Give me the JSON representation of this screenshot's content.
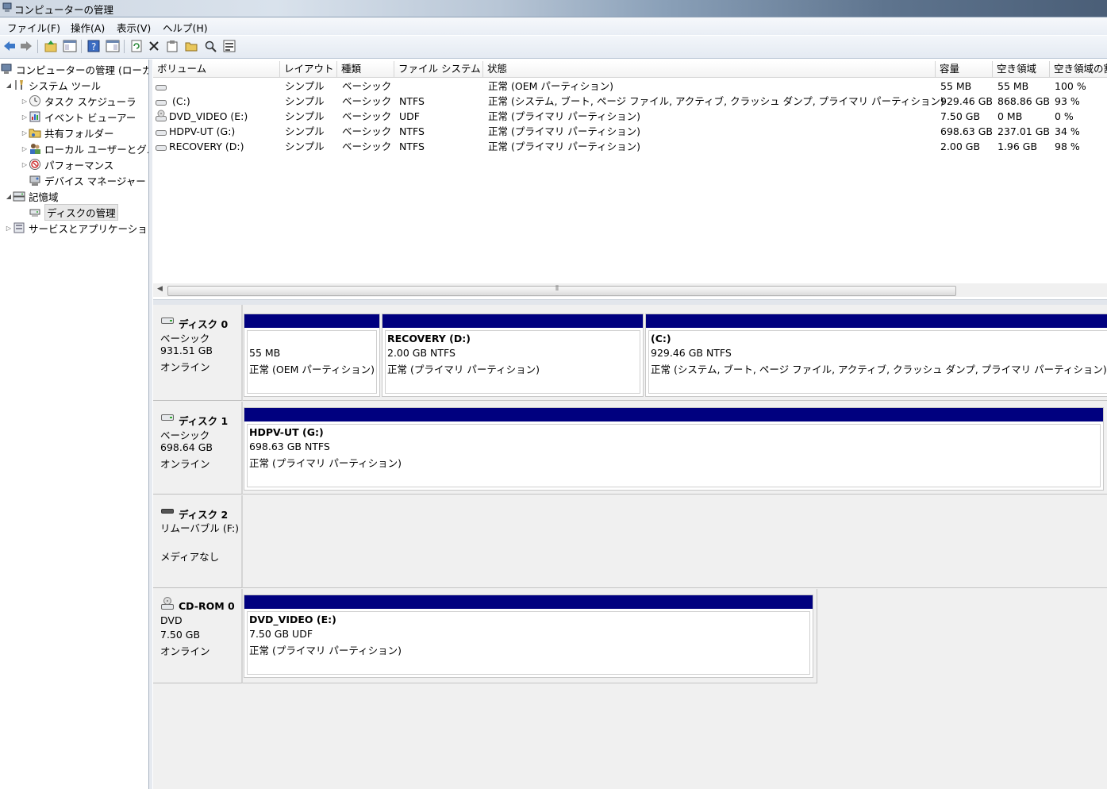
{
  "window": {
    "title": "コンピューターの管理"
  },
  "menu": [
    "ファイル(F)",
    "操作(A)",
    "表示(V)",
    "ヘルプ(H)"
  ],
  "toolbar_icons": [
    "back-arrow-icon",
    "forward-arrow-icon",
    "up-folder-icon",
    "show-hide-tree-icon",
    "help-icon",
    "action-pane-icon",
    "refresh-icon",
    "delete-icon",
    "properties-icon",
    "open-folder-icon",
    "search-icon",
    "settings-icon"
  ],
  "tree": {
    "root": "コンピューターの管理 (ローカル)",
    "system_tools": "システム ツール",
    "task_scheduler": "タスク スケジューラ",
    "event_viewer": "イベント ビューアー",
    "shared_folders": "共有フォルダー",
    "local_users": "ローカル ユーザーとグループ",
    "performance": "パフォーマンス",
    "device_manager": "デバイス マネージャー",
    "storage": "記憶域",
    "disk_management": "ディスクの管理",
    "services": "サービスとアプリケーション"
  },
  "volume_columns": {
    "volume": "ボリューム",
    "layout": "レイアウト",
    "type": "種類",
    "fs": "ファイル システム",
    "status": "状態",
    "capacity": "容量",
    "free": "空き領域",
    "pct": "空き領域の割合"
  },
  "volumes": [
    {
      "name": "",
      "layout": "シンプル",
      "type": "ベーシック",
      "fs": "",
      "status": "正常 (OEM パーティション)",
      "capacity": "55 MB",
      "free": "55 MB",
      "pct": "100 %"
    },
    {
      "name": "(C:)",
      "layout": "シンプル",
      "type": "ベーシック",
      "fs": "NTFS",
      "status": "正常 (システム, ブート, ページ ファイル, アクティブ, クラッシュ ダンプ, プライマリ パーティション)",
      "capacity": "929.46 GB",
      "free": "868.86 GB",
      "pct": "93 %"
    },
    {
      "name": "DVD_VIDEO (E:)",
      "layout": "シンプル",
      "type": "ベーシック",
      "fs": "UDF",
      "status": "正常 (プライマリ パーティション)",
      "capacity": "7.50 GB",
      "free": "0 MB",
      "pct": "0 %"
    },
    {
      "name": "HDPV-UT (G:)",
      "layout": "シンプル",
      "type": "ベーシック",
      "fs": "NTFS",
      "status": "正常 (プライマリ パーティション)",
      "capacity": "698.63 GB",
      "free": "237.01 GB",
      "pct": "34 %"
    },
    {
      "name": "RECOVERY (D:)",
      "layout": "シンプル",
      "type": "ベーシック",
      "fs": "NTFS",
      "status": "正常 (プライマリ パーティション)",
      "capacity": "2.00 GB",
      "free": "1.96 GB",
      "pct": "98 %"
    }
  ],
  "hscroll_grip": "⦀",
  "disks": {
    "disk0": {
      "title": "ディスク 0",
      "type": "ベーシック",
      "size": "931.51 GB",
      "state": "オンライン",
      "p1": {
        "size": "55 MB",
        "status": "正常 (OEM パーティション)"
      },
      "p2": {
        "name": "RECOVERY  (D:)",
        "size": "2.00 GB NTFS",
        "status": "正常 (プライマリ パーティション)"
      },
      "p3": {
        "name": " (C:)",
        "size": "929.46 GB NTFS",
        "status": "正常 (システム, ブート, ページ ファイル, アクティブ, クラッシュ ダンプ, プライマリ パーティション)"
      }
    },
    "disk1": {
      "title": "ディスク 1",
      "type": "ベーシック",
      "size": "698.64 GB",
      "state": "オンライン",
      "p1": {
        "name": "HDPV-UT  (G:)",
        "size": "698.63 GB NTFS",
        "status": "正常 (プライマリ パーティション)"
      }
    },
    "disk2": {
      "title": "ディスク 2",
      "type": "リムーバブル (F:)",
      "state": "メディアなし"
    },
    "cdrom0": {
      "title": "CD-ROM 0",
      "type": "DVD",
      "size": "7.50 GB",
      "state": "オンライン",
      "p1": {
        "name": "DVD_VIDEO  (E:)",
        "size": "7.50 GB UDF",
        "status": "正常 (プライマリ パーティション)"
      }
    }
  },
  "colors": {
    "partition_bar": "#00007f"
  }
}
